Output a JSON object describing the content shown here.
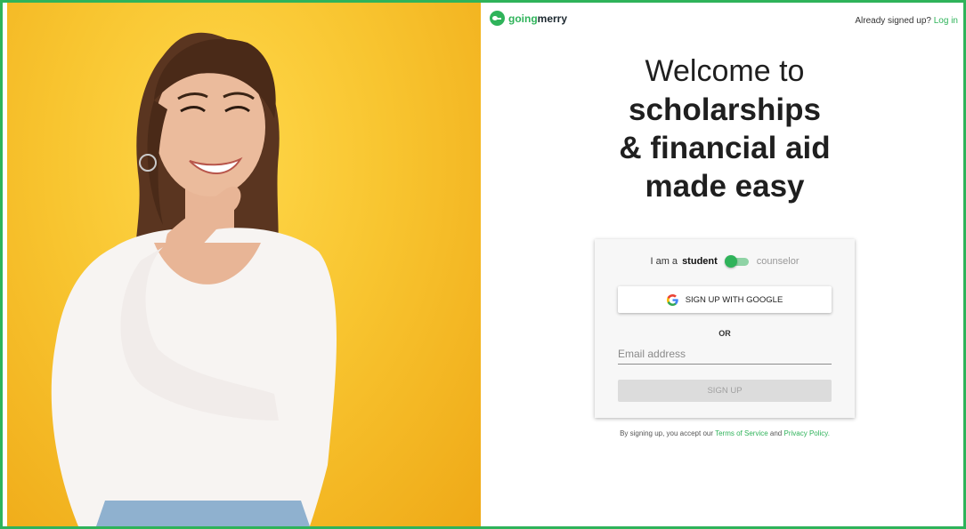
{
  "header": {
    "logo_going": "going",
    "logo_merry": "merry",
    "already_text": "Already signed up?",
    "login_link": "Log in"
  },
  "hero": {
    "line1": "Welcome to",
    "line2": "scholarships",
    "line3": "& financial aid",
    "line4": "made easy"
  },
  "form": {
    "role_prefix": "I am a",
    "role_student": "student",
    "role_counselor": "counselor",
    "role_selected": "student",
    "google_label": "SIGN UP WITH GOOGLE",
    "or_label": "OR",
    "email_placeholder": "Email address",
    "email_value": "",
    "signup_label": "SIGN UP"
  },
  "terms": {
    "prefix": "By signing up, you accept our",
    "tos": "Terms of Service",
    "and": "and",
    "privacy": "Privacy Policy."
  },
  "colors": {
    "brand_green": "#2fb35a",
    "hero_yellow": "#f8c530"
  }
}
